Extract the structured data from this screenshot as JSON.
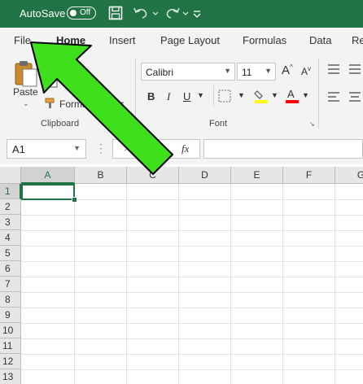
{
  "titlebar": {
    "autosave_label": "AutoSave",
    "autosave_state": "Off",
    "icons": [
      "save-icon",
      "undo-icon",
      "redo-icon",
      "customize-toolbar-icon"
    ],
    "bg_color": "#217346"
  },
  "tabs": [
    "File",
    "Home",
    "Insert",
    "Page Layout",
    "Formulas",
    "Data",
    "Re"
  ],
  "active_tab": "Home",
  "ribbon": {
    "clipboard": {
      "paste_label": "Paste",
      "format_painter_label": "Format Painter",
      "group_label": "Clipboard"
    },
    "font": {
      "font_name": "Calibri",
      "font_size": "11",
      "bold": "B",
      "italic": "I",
      "underline": "U",
      "group_label": "Font",
      "fill_color": "#ffff00",
      "font_color": "#ff0000"
    }
  },
  "formula_bar": {
    "name_box": "A1",
    "fx_label": "fx",
    "formula": ""
  },
  "sheet": {
    "columns": [
      "A",
      "B",
      "C",
      "D",
      "E",
      "F",
      "G"
    ],
    "rows": [
      "1",
      "2",
      "3",
      "4",
      "5",
      "6",
      "7",
      "8",
      "9",
      "10",
      "11",
      "12",
      "13"
    ],
    "selected_cell": "A1",
    "accent": "#217346"
  },
  "annotation": {
    "arrow_color": "#3ee01b",
    "points_to": "File"
  }
}
